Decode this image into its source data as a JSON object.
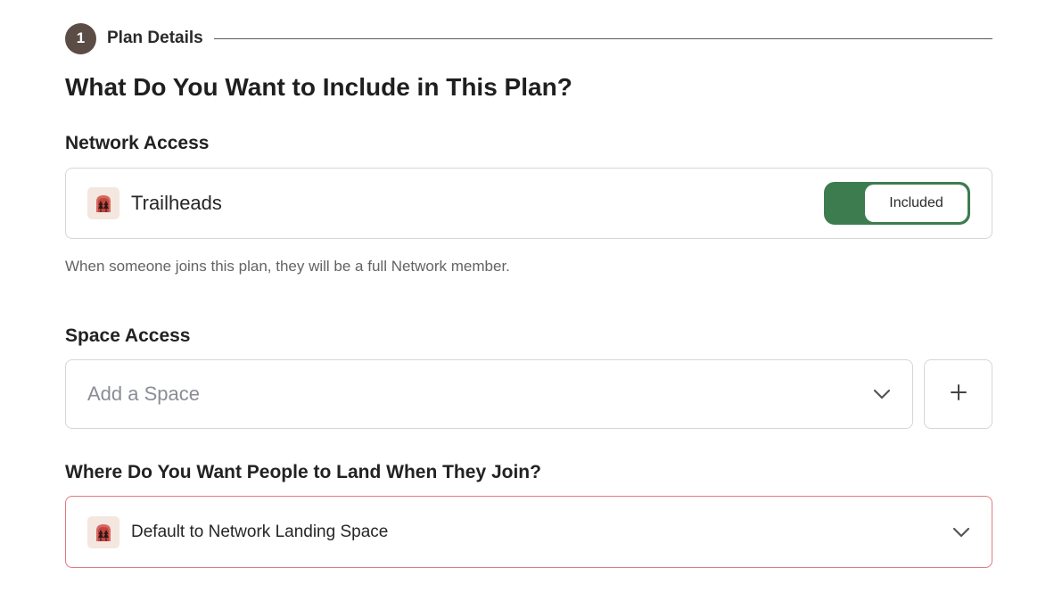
{
  "step": {
    "number": "1",
    "label": "Plan Details"
  },
  "title": "What Do You Want to Include in This Plan?",
  "network_access": {
    "label": "Network Access",
    "item_name": "Trailheads",
    "item_icon": "trailheads-logo-icon",
    "toggle_label": "Included",
    "toggle_color": "#3d7c4f",
    "helper_text": "When someone joins this plan, they will be a full Network member."
  },
  "space_access": {
    "label": "Space Access",
    "placeholder": "Add a Space",
    "dropdown_icon": "chevron-down-icon",
    "add_icon": "plus-icon"
  },
  "landing": {
    "label": "Where Do You Want People to Land When They Join?",
    "selected_value": "Default to Network Landing Space",
    "item_icon": "trailheads-logo-icon",
    "border_color": "#e27a7f"
  }
}
